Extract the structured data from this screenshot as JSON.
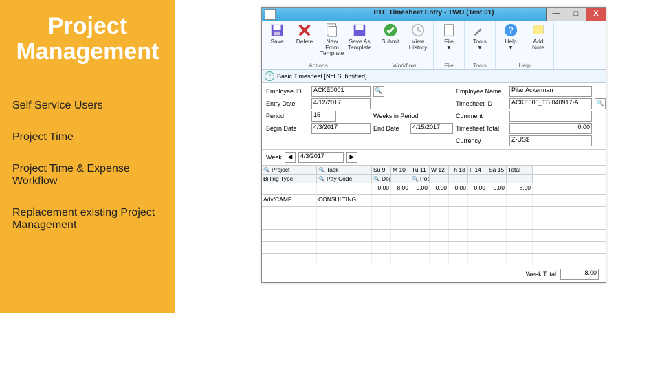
{
  "sidebar": {
    "title": "Project Management",
    "items": [
      "Self Service Users",
      "Project Time",
      "Project Time & Expense Workflow",
      "Replacement existing Project Management"
    ]
  },
  "window": {
    "title": "PTE Timesheet Entry - TWO (Test 01)",
    "min": "—",
    "max": "□",
    "close": "X"
  },
  "ribbon": {
    "groups": [
      {
        "name": "Actions",
        "btns": [
          {
            "k": "save",
            "l": "Save"
          },
          {
            "k": "delete",
            "l": "Delete"
          },
          {
            "k": "newfrom",
            "l": "New From\nTemplate"
          },
          {
            "k": "saveas",
            "l": "Save As\nTemplate"
          }
        ]
      },
      {
        "name": "Workflow",
        "btns": [
          {
            "k": "submit",
            "l": "Submit"
          },
          {
            "k": "viewhist",
            "l": "View\nHistory"
          }
        ]
      },
      {
        "name": "File",
        "btns": [
          {
            "k": "file",
            "l": "File\n▼"
          }
        ]
      },
      {
        "name": "Tools",
        "btns": [
          {
            "k": "tools",
            "l": "Tools\n▼"
          }
        ]
      },
      {
        "name": "Help",
        "btns": [
          {
            "k": "help",
            "l": "Help\n▼"
          },
          {
            "k": "addnote",
            "l": "Add\nNote"
          }
        ]
      }
    ]
  },
  "info": {
    "icon": "?",
    "text": "Basic Timesheet [Not Submitted]"
  },
  "form": {
    "employee_id_l": "Employee ID",
    "employee_id": "ACKE0001",
    "employee_name_l": "Employee Name",
    "employee_name": "Pilar Ackerman",
    "entry_date_l": "Entry Date",
    "entry_date": "4/12/2017",
    "timesheet_id_l": "Timesheet ID",
    "timesheet_id": "ACKE000_TS 040917-A",
    "period_l": "Period",
    "period": "15",
    "weeks_l": "Weeks in Period",
    "comment_l": "Comment",
    "comment": "",
    "begin_l": "Begin Date",
    "begin": "4/3/2017",
    "end_l": "End Date",
    "end": "4/15/2017",
    "ts_total_l": "Timesheet Total",
    "ts_total": "0.00",
    "currency_l": "Currency",
    "currency": "Z-US$"
  },
  "week": {
    "label": "Week",
    "value": "4/3/2017"
  },
  "grid": {
    "h1": [
      "Project ",
      "Task ",
      "Su 9",
      "M 10",
      "Tu 11",
      "W 12",
      "Th 13",
      "F 14",
      "Sa 15",
      "Total"
    ],
    "h2": [
      "Billing Type",
      "Pay Code",
      "Department",
      "",
      "Position",
      "",
      "",
      "",
      "",
      ""
    ],
    "row1": [
      "",
      "",
      "0.00",
      "8.00",
      "0.00",
      "0.00",
      "0.00",
      "0.00",
      "0.00",
      "8.00"
    ],
    "row2": [
      "Adv/CAMP",
      "CONSULTING",
      "",
      "",
      "",
      "",
      "",
      "",
      "",
      ""
    ]
  },
  "footer": {
    "label": "Week Total",
    "value": "8.00"
  }
}
